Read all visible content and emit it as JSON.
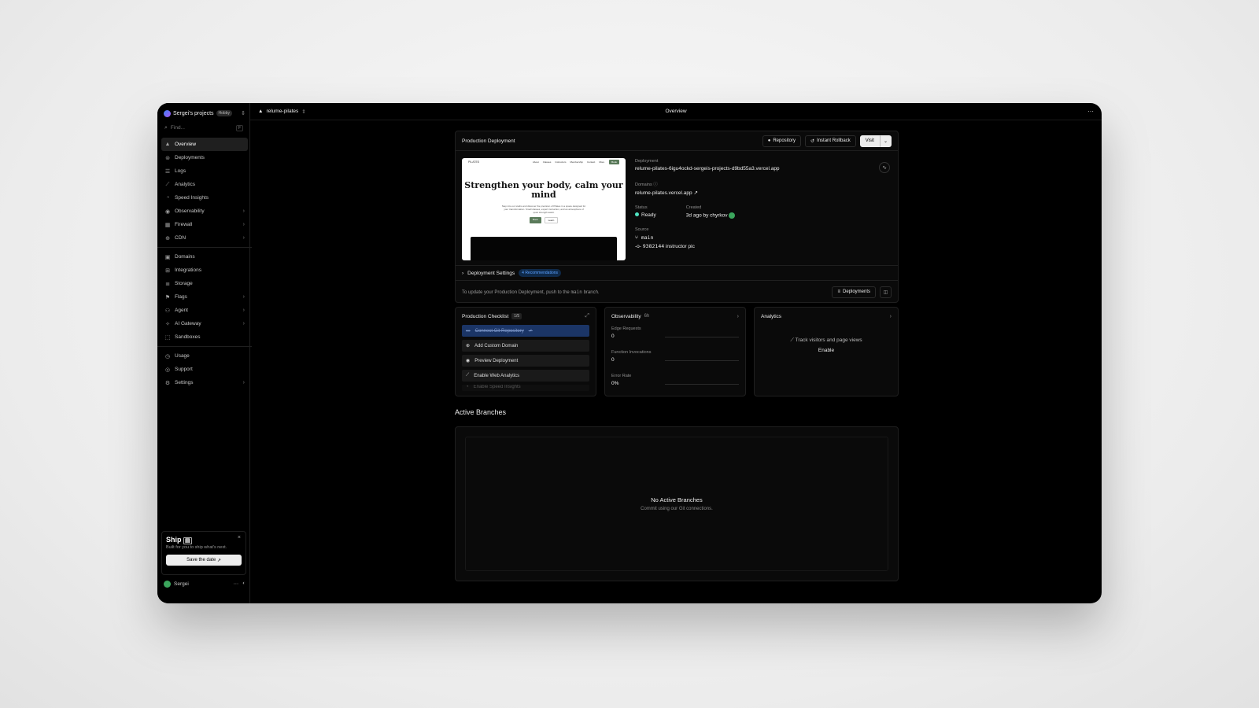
{
  "sidebar": {
    "project_name": "Sergei's projects",
    "plan_badge": "Hobby",
    "find_placeholder": "Find...",
    "find_shortcut": "F",
    "nav_primary": [
      {
        "label": "Overview",
        "icon": "triangle-icon",
        "active": true,
        "arrow": false
      },
      {
        "label": "Deployments",
        "icon": "layers-icon",
        "arrow": false
      },
      {
        "label": "Logs",
        "icon": "list-icon",
        "arrow": false
      },
      {
        "label": "Analytics",
        "icon": "chart-icon",
        "arrow": false
      },
      {
        "label": "Speed Insights",
        "icon": "gauge-icon",
        "arrow": false
      },
      {
        "label": "Observability",
        "icon": "eye-icon",
        "arrow": true
      },
      {
        "label": "Firewall",
        "icon": "firewall-icon",
        "arrow": true
      },
      {
        "label": "CDN",
        "icon": "globe-icon",
        "arrow": true
      }
    ],
    "nav_secondary": [
      {
        "label": "Domains",
        "icon": "domain-icon",
        "arrow": false
      },
      {
        "label": "Integrations",
        "icon": "puzzle-icon",
        "arrow": false
      },
      {
        "label": "Storage",
        "icon": "database-icon",
        "arrow": false
      },
      {
        "label": "Flags",
        "icon": "flag-icon",
        "arrow": true
      },
      {
        "label": "Agent",
        "icon": "agent-icon",
        "arrow": true
      },
      {
        "label": "AI Gateway",
        "icon": "ai-icon",
        "arrow": true
      },
      {
        "label": "Sandboxes",
        "icon": "sandbox-icon",
        "arrow": false
      }
    ],
    "nav_tertiary": [
      {
        "label": "Usage",
        "icon": "usage-icon",
        "arrow": false
      },
      {
        "label": "Support",
        "icon": "support-icon",
        "arrow": false
      },
      {
        "label": "Settings",
        "icon": "gear-icon",
        "arrow": true
      }
    ],
    "ship": {
      "title": "Ship",
      "subtitle": "Built for you to ship what's next.",
      "button": "Save the date"
    },
    "user": "Sergei"
  },
  "topbar": {
    "project": "relume-pilates",
    "title": "Overview"
  },
  "production": {
    "title": "Production Deployment",
    "btn_repository": "Repository",
    "btn_rollback": "Instant Rollback",
    "btn_visit": "Visit",
    "preview": {
      "logo": "PILATES",
      "links": [
        "About",
        "Classes",
        "Instructors",
        "Membership",
        "Contact",
        "More"
      ],
      "cta": "Book",
      "heading": "Strengthen your body, calm your mind",
      "para": "Step into our studio and discover the precision of Pilates in a space designed for your transformation. Small classes, expert instruction, and an atmosphere of quiet strength await.",
      "btn1": "Book",
      "btn2": "Learn"
    },
    "deployment_label": "Deployment",
    "deployment_url": "relume-pilates-6igu4ockd-sergeis-projects-d9bd55a3.vercel.app",
    "domains_label": "Domains",
    "domain": "relume-pilates.vercel.app",
    "status_label": "Status",
    "status": "Ready",
    "created_label": "Created",
    "created": "3d ago by chyrkov",
    "source_label": "Source",
    "branch": "main",
    "commit": "9382144",
    "commit_msg": "instructor pic",
    "settings_label": "Deployment Settings",
    "recommendations": "4 Recommendations",
    "update_pre": "To update your Production Deployment, push to the",
    "update_branch": "main",
    "update_post": "branch.",
    "btn_deployments": "Deployments",
    "colors": {
      "ready": "#50e3c2",
      "accent": "#5aa0ff"
    }
  },
  "checklist": {
    "title": "Production Checklist",
    "count": "1/5",
    "items": [
      {
        "label": "Connect Git Repository",
        "icon": "git-icon",
        "done": true
      },
      {
        "label": "Add Custom Domain",
        "icon": "globe-icon"
      },
      {
        "label": "Preview Deployment",
        "icon": "eye-icon"
      },
      {
        "label": "Enable Web Analytics",
        "icon": "chart-icon"
      },
      {
        "label": "Enable Speed Insights",
        "icon": "gauge-icon"
      }
    ]
  },
  "observability": {
    "title": "Observability",
    "range": "6h",
    "metrics": [
      {
        "label": "Edge Requests",
        "value": "0"
      },
      {
        "label": "Function Invocations",
        "value": "0"
      },
      {
        "label": "Error Rate",
        "value": "0%"
      }
    ]
  },
  "analytics": {
    "title": "Analytics",
    "text": "Track visitors and page views",
    "link": "Enable"
  },
  "branches": {
    "title": "Active Branches",
    "empty_title": "No Active Branches",
    "empty_sub": "Commit using our Git connections."
  }
}
